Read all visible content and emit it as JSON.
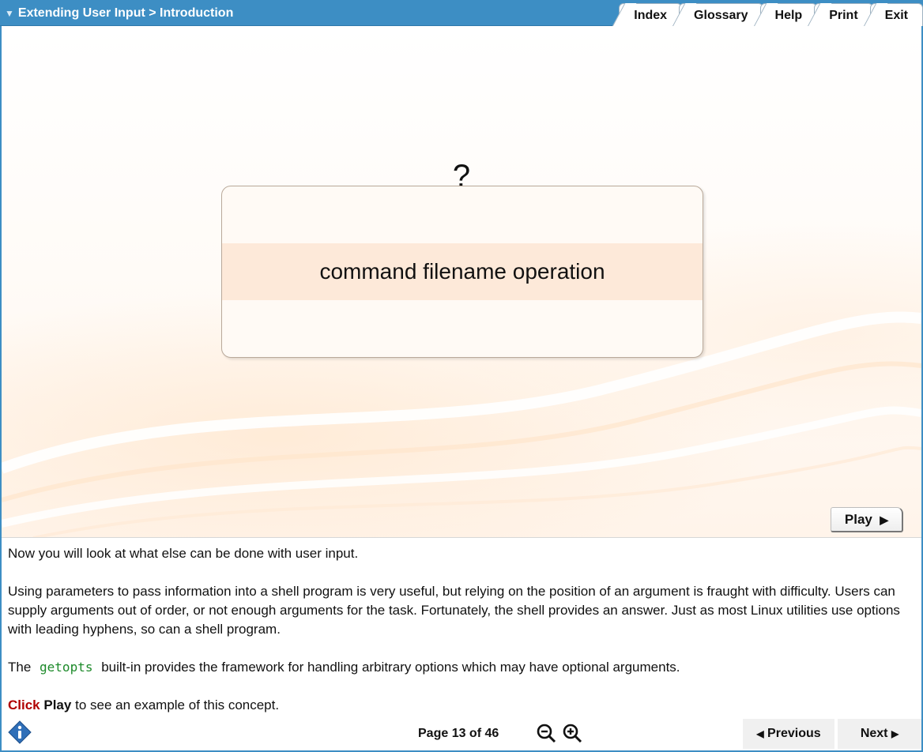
{
  "header": {
    "breadcrumb": "Extending User Input > Introduction",
    "collapse_glyph": "▼",
    "tabs": [
      {
        "label": "Index"
      },
      {
        "label": "Glossary"
      },
      {
        "label": "Help"
      },
      {
        "label": "Print"
      },
      {
        "label": "Exit"
      }
    ]
  },
  "stage": {
    "question_mark": "?",
    "command_text": "command filename operation",
    "play_label": "Play",
    "play_glyph": "▶"
  },
  "content": {
    "para1": "Now you will look at what else can be done with user input.",
    "para2": "Using parameters to pass information into a shell program is very useful, but relying on the position of an argument is fraught with difficulty. Users can supply arguments out of order, or not enough arguments for the task. Fortunately, the shell provides an answer. Just as most Linux utilities use options with leading hyphens, so can a shell program.",
    "para3_before": "The",
    "para3_code": "getopts",
    "para3_after": "built-in provides the framework for handling arbitrary options which may have optional arguments.",
    "para4_click": "Click",
    "para4_play": "Play",
    "para4_after": "to see an example of this concept."
  },
  "footer": {
    "page_text": "Page 13 of 46",
    "previous_label": "Previous",
    "previous_glyph": "◀",
    "next_label": "Next",
    "next_glyph": "▶"
  },
  "icons": {
    "info": "info-icon",
    "zoom_out": "zoom-out-icon",
    "zoom_in": "zoom-in-icon"
  },
  "colors": {
    "header_blue": "#3d8ec4",
    "code_green": "#1d8a2a",
    "click_red": "#b00000",
    "command_band": "#fde9d9"
  }
}
